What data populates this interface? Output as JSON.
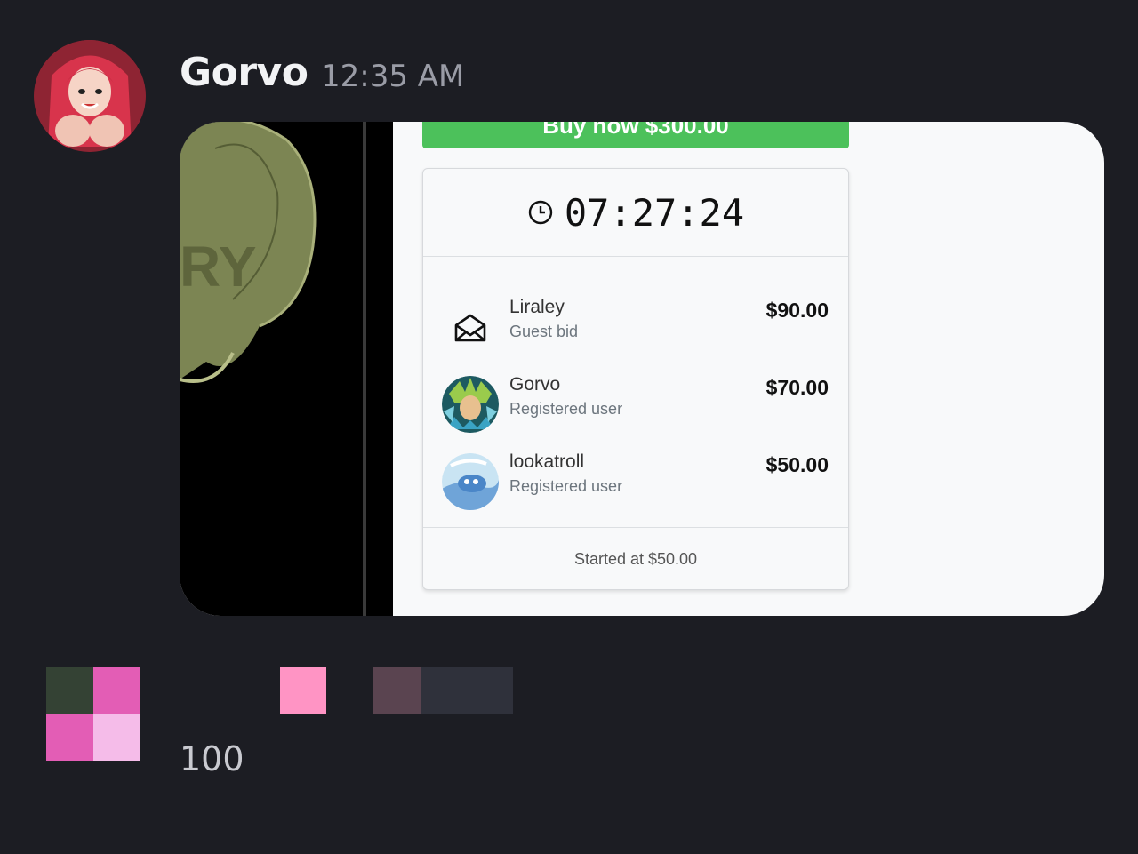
{
  "message": {
    "author": "Gorvo",
    "timestamp": "12:35 AM"
  },
  "embed": {
    "buy_button_label": "Buy now $300.00",
    "timer": "07:27:24",
    "bids": [
      {
        "name": "Liraley",
        "type": "Guest bid",
        "amount": "$90.00",
        "icon": "envelope-icon"
      },
      {
        "name": "Gorvo",
        "type": "Registered user",
        "amount": "$70.00",
        "icon": "avatar"
      },
      {
        "name": "lookatroll",
        "type": "Registered user",
        "amount": "$50.00",
        "icon": "avatar"
      }
    ],
    "started_at": "Started at $50.00"
  },
  "reactions": {
    "count": "100"
  },
  "colors": {
    "background": "#1c1d23",
    "buy_button": "#4cc15b",
    "pixel_dark_green": "#344234",
    "pixel_pink": "#e35db5",
    "pixel_light_pink": "#f5bce9",
    "pixel_salmon_pink": "#ff94c4",
    "pixel_mauve": "#5a4450",
    "pixel_slate": "#2f313b"
  }
}
